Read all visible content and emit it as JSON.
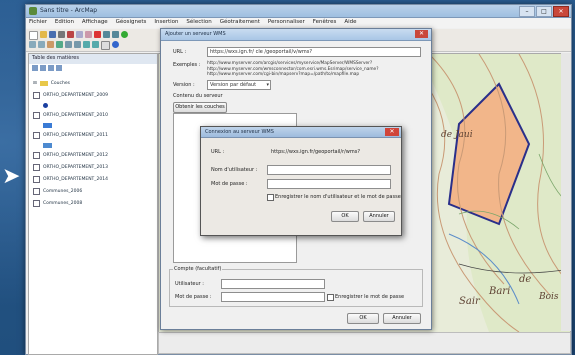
{
  "app": {
    "title": "Sans titre - ArcMap"
  },
  "menu": [
    "Fichier",
    "Edition",
    "Affichage",
    "Géosignets",
    "Insertion",
    "Sélection",
    "Géotraitement",
    "Personnaliser",
    "Fenêtres",
    "Aide"
  ],
  "toc": {
    "title": "Table des matières",
    "layers": [
      {
        "label": "Couches",
        "color": "#ffffff"
      },
      {
        "label": "ORTHO_DEPARTEMENT_2009",
        "color": "#3a7bd5"
      },
      {
        "label": "ORTHO_DEPARTEMENT_2010",
        "color": "#6fa9e8"
      },
      {
        "label": "ORTHO_DEPARTEMENT_2011",
        "color": "#4d8ad0"
      },
      {
        "label": "ORTHO_DEPARTEMENT_2012",
        "color": "#2d6bb6"
      },
      {
        "label": "ORTHO_DEPARTEMENT_2013",
        "color": "#5fa0de"
      },
      {
        "label": "ORTHO_DEPARTEMENT_2014",
        "color": "#8fbde8"
      },
      {
        "label": "Communes_2006",
        "color": "#7b7b7b"
      },
      {
        "label": "Communes_2008",
        "color": "#7b7b7b"
      }
    ]
  },
  "map": {
    "labels": [
      "de Jaui",
      "Bois",
      "Bari",
      "de",
      "Sair"
    ],
    "polygon_color": "#f2b68a",
    "contour_color": "#c99a76"
  },
  "wms_dialog": {
    "title": "Ajouter un serveur WMS",
    "url_label": "URL :",
    "url_value": "https://wxs.ign.fr/ cle /geoportail/v/wms?",
    "examples_label": "Exemples :",
    "example_lines": [
      "http://www.myserver.com/arcgis/services/myservice/MapServer/WMSServer?",
      "http://www.myserver.com/wmsconnector/com.esri.wms.Esrimap/service_name?",
      "http://www.myserver.com/cgi-bin/mapserv?map=/path/to/mapfile.map"
    ],
    "version_label": "Version :",
    "version_value": "Version par défaut",
    "details_label": "Contenu du serveur",
    "layers_button": "Obtenir les couches",
    "account_group": "Compte (facultatif)",
    "user_label": "Utilisateur :",
    "password_label": "Mot de passe :",
    "save_label": "Enregistrer le mot de passe",
    "ok": "OK",
    "cancel": "Annuler"
  },
  "auth_dialog": {
    "title": "Connexion au serveur WMS",
    "url_label": "URL :",
    "url_value": "https://wxs.ign.fr/geoportail/r/wms?",
    "user_label": "Nom d'utilisateur :",
    "password_label": "Mot de passe :",
    "save_label": "Enregistrer le nom d'utilisateur et le mot de passe",
    "ok": "OK",
    "cancel": "Annuler"
  },
  "colors": {
    "desktop": "#234f7e",
    "close": "#c9473a"
  }
}
